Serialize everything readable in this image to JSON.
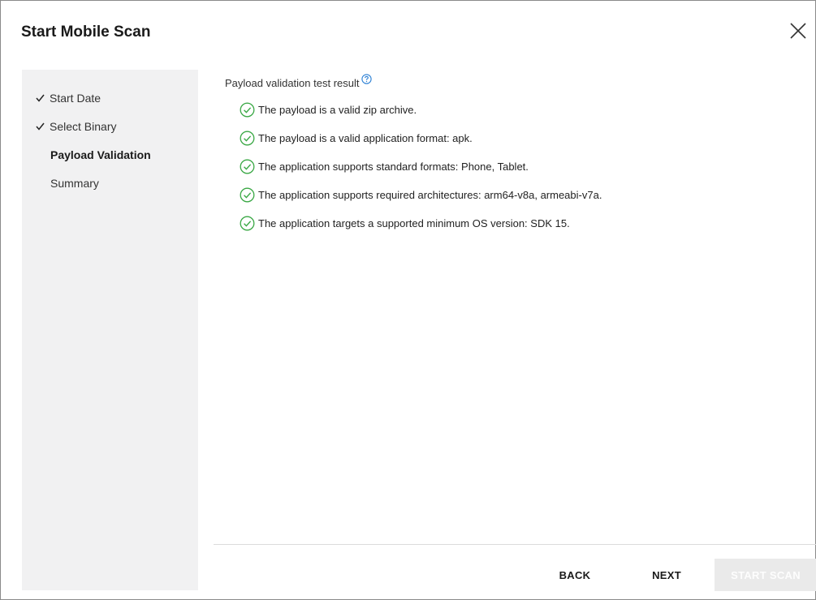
{
  "dialog": {
    "title": "Start Mobile Scan"
  },
  "steps": [
    {
      "label": "Start Date",
      "state": "completed"
    },
    {
      "label": "Select Binary",
      "state": "completed"
    },
    {
      "label": "Payload Validation",
      "state": "current"
    },
    {
      "label": "Summary",
      "state": "pending"
    }
  ],
  "validation": {
    "heading": "Payload validation test result",
    "results": [
      {
        "text": "The payload is a valid zip archive.",
        "status": "pass"
      },
      {
        "text": "The payload is a valid application format: apk.",
        "status": "pass"
      },
      {
        "text": "The application supports standard formats: Phone, Tablet.",
        "status": "pass"
      },
      {
        "text": "The application supports required architectures: arm64-v8a, armeabi-v7a.",
        "status": "pass"
      },
      {
        "text": "The application targets a supported minimum OS version: SDK 15.",
        "status": "pass"
      }
    ]
  },
  "footer": {
    "back_label": "BACK",
    "next_label": "NEXT",
    "start_label": "START SCAN"
  },
  "colors": {
    "success": "#3aa845",
    "help": "#2a7fd4",
    "sidebar_bg": "#f1f1f2",
    "disabled_button_bg": "#eaeaea"
  },
  "icons": {
    "close": "close-icon",
    "help": "help-icon",
    "completed_step": "checkmark-icon",
    "result_pass": "check-circle-icon"
  }
}
